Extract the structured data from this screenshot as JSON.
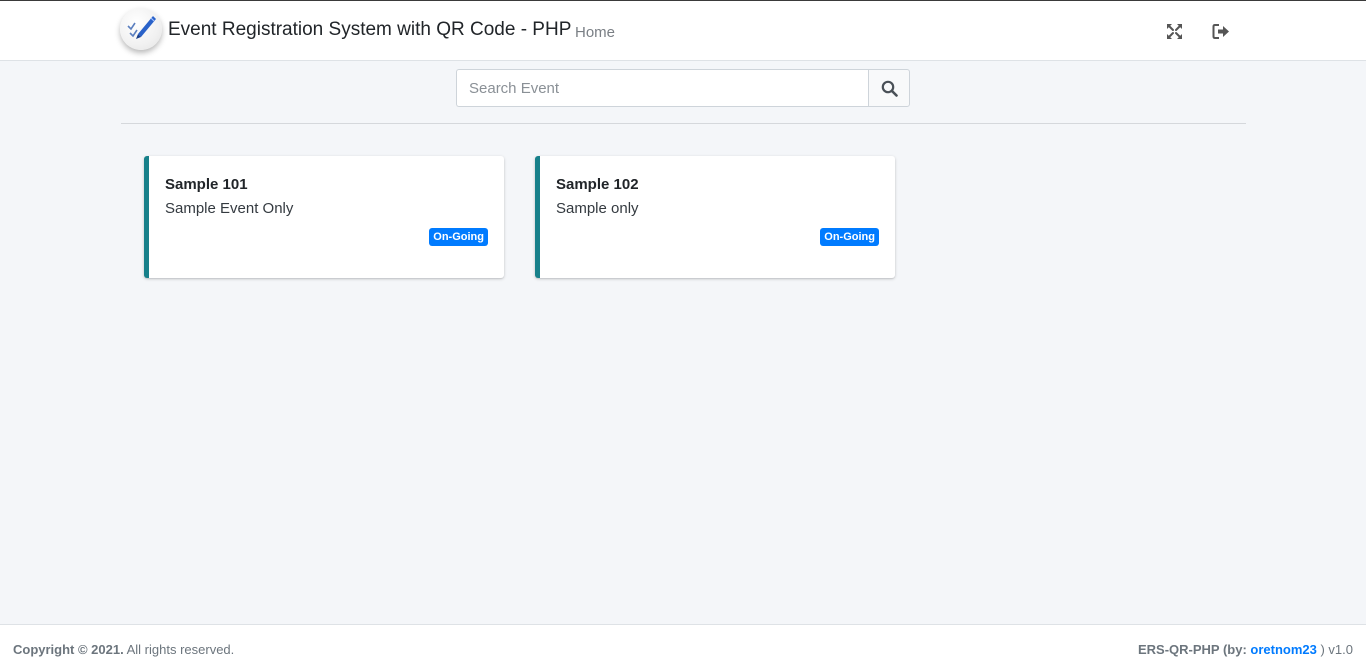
{
  "navbar": {
    "brand_title": "Event Registration System with QR Code - PHP",
    "home_link": "Home",
    "icons": [
      "logo-icon",
      "fullscreen-icon",
      "logout-icon"
    ]
  },
  "search": {
    "placeholder": "Search Event",
    "value": "",
    "button_icon": "search-icon"
  },
  "events": [
    {
      "title": "Sample 101",
      "description": "Sample Event Only",
      "status": "On-Going"
    },
    {
      "title": "Sample 102",
      "description": "Sample only",
      "status": "On-Going"
    }
  ],
  "footer": {
    "copyright_prefix": "Copyright © 2021.",
    "copyright_suffix": " All rights reserved.",
    "app_name": "ERS-QR-PHP (by: ",
    "author_link": "oretnom23",
    "version": " ) v1.0"
  },
  "colors": {
    "accent": "#17808a",
    "badge": "#007bff",
    "background": "#f4f6f9",
    "link": "#007bff"
  }
}
